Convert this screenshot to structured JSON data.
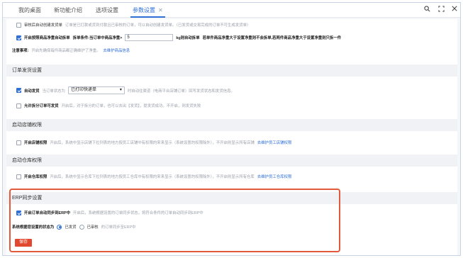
{
  "tabs": [
    {
      "label": "我的桌面"
    },
    {
      "label": "新功能介绍"
    },
    {
      "label": "选项设置"
    },
    {
      "label": "参数设置",
      "close": "✕"
    }
  ],
  "window_controls": {
    "search": "🔍",
    "maximize": "⛶",
    "close": "✕"
  },
  "top_rows": {
    "auto_ship": {
      "label": "审核后自动创建发货单",
      "hint": "订单是已打款或货到付款且已审核的订单，可以自动创建发货单。（已发货或交易完成的订单不可生成发货单）"
    },
    "split": {
      "label": "开启按照商品净重自动拆单",
      "split_label": "拆单条件:当订单中商品净重>",
      "input_value": "5",
      "unit_text": "kg则自动拆单",
      "rule": "若单件商品净重大于设置净重则不会拆单,若两件商品净重大于设置净重则只拆一件"
    },
    "note": {
      "label": "注意事项:",
      "hint": "开启先确保每件商品都正确维护了净重。",
      "link": "去维护商品信息"
    }
  },
  "sections": {
    "order_ship": {
      "title": "订单发货设置",
      "auto_ship": {
        "label": "自动发货",
        "prefix": "当订单状态为",
        "select_value": "已打印快递单",
        "hint": "时自动往渠道（电商平台店铺订单）回写发货状态和发货信息。"
      },
      "split_ship": {
        "label": "允许拆分订单可发货",
        "hint": "开启后，对于拆分的订单，也可以去出【发货】，提发货成功。不开启，则发货失败"
      }
    },
    "store_perm": {
      "title": "启动店铺权限",
      "row": {
        "label": "开启店铺权限",
        "hint": "开启后，系统中显示店铺下拉列表的地方按员工店铺中有权限的来来显示（系统设置的权限除外），不开启则显示所有店铺",
        "link": "去维护员工店铺权限"
      }
    },
    "warehouse_perm": {
      "title": "启动仓库权限",
      "row": {
        "label": "开启仓库权限",
        "hint": "开启后，系统中显示仓库下拉列表的地方按员工仓库中有权限的来来显示（系统设置的权限除外），不开启则显示所有仓库",
        "link": "去维护员工仓库权限"
      }
    },
    "erp": {
      "title": "ERP同步设置",
      "sync": {
        "label": "开启订单自动同步到ERP中",
        "hint": "开启后，系统根据设置的订单同步状态，将符合条件的订单自动同步到ERP中"
      },
      "status": {
        "label": "系统根据您设置的状态为",
        "option1": "已发货",
        "option2": "已审核",
        "hint": "的订单同步至ERP中"
      }
    }
  },
  "save_label": "保存",
  "colors": {
    "accent": "#2f6fd6",
    "highlight": "#e25a3b",
    "save": "#e0492f"
  }
}
